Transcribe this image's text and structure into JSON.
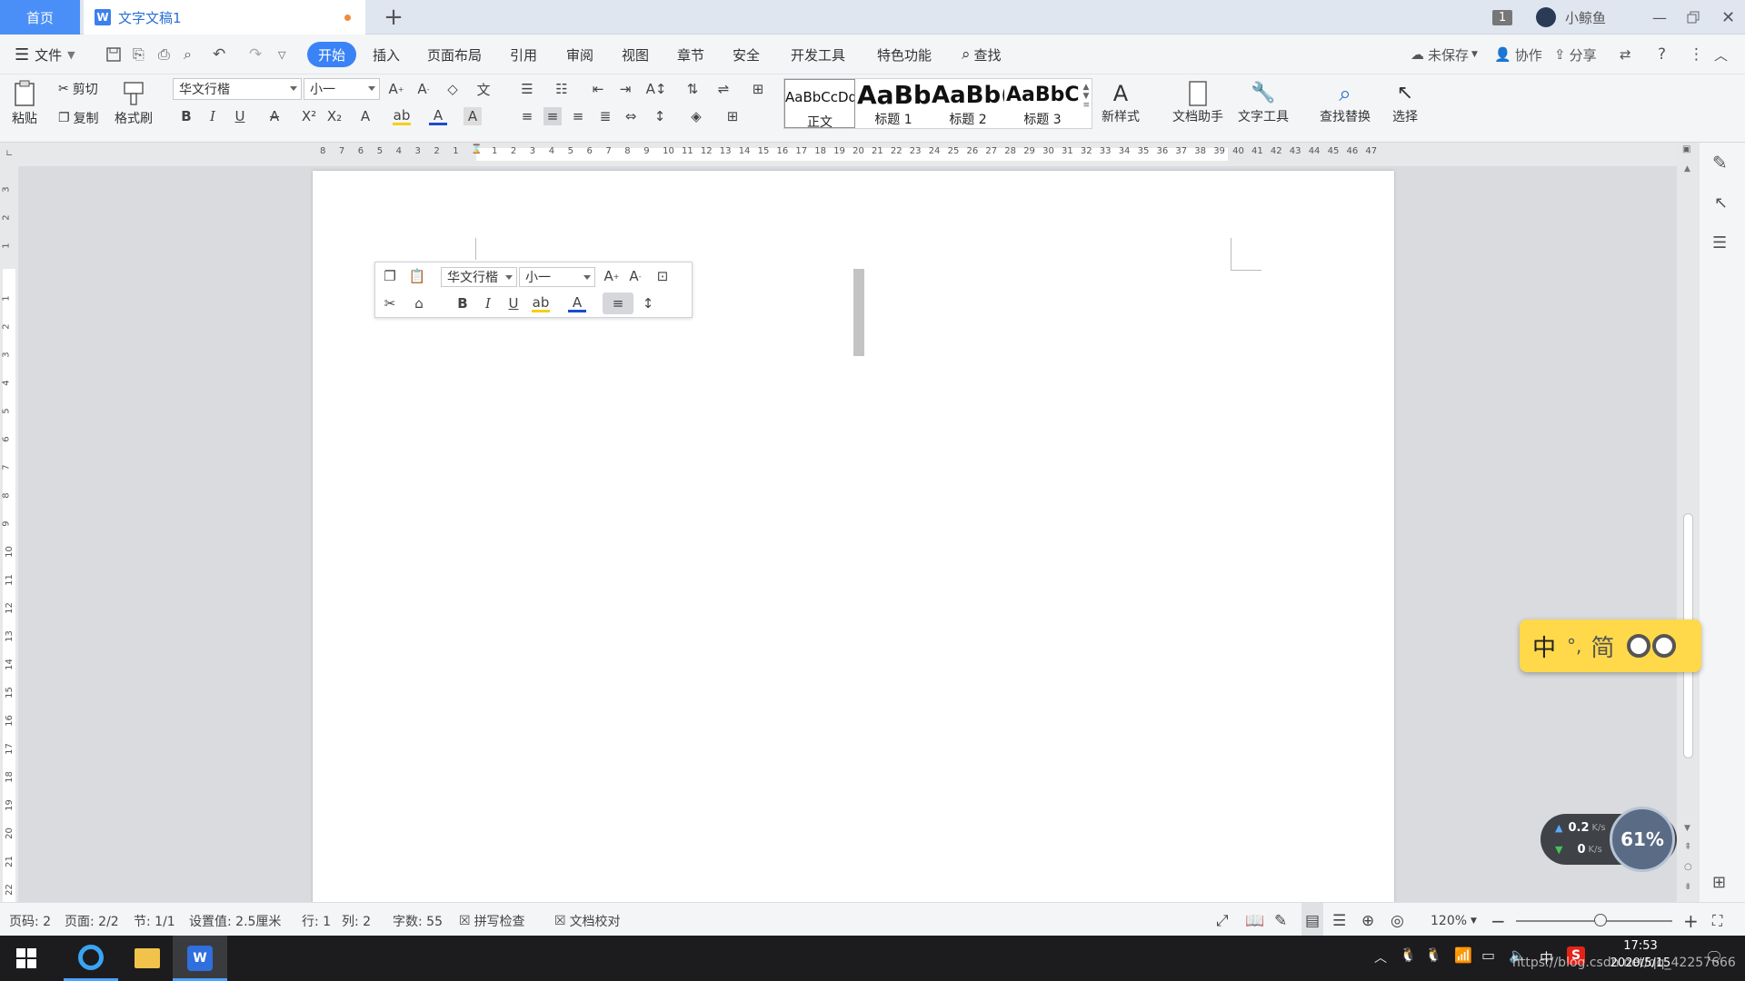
{
  "titlebar": {
    "home_tab": "首页",
    "doc_tab": "文字文稿1",
    "notification_count": "1",
    "username": "小鲸鱼"
  },
  "menu": {
    "file": "文件",
    "items": [
      "开始",
      "插入",
      "页面布局",
      "引用",
      "审阅",
      "视图",
      "章节",
      "安全",
      "开发工具",
      "特色功能"
    ],
    "search": "查找",
    "unsaved": "未保存",
    "collab": "协作",
    "share": "分享"
  },
  "ribbon": {
    "paste": "粘贴",
    "cut": "剪切",
    "copy": "复制",
    "format_painter": "格式刷",
    "font_name": "华文行楷",
    "font_size": "小一",
    "styles": [
      {
        "preview": "AaBbCcDd",
        "label": "正文"
      },
      {
        "preview": "AaBb",
        "label": "标题 1"
      },
      {
        "preview": "AaBb(",
        "label": "标题 2"
      },
      {
        "preview": "AaBbC",
        "label": "标题 3"
      }
    ],
    "new_style": "新样式",
    "doc_assistant": "文档助手",
    "text_tools": "文字工具",
    "find_replace": "查找替换",
    "select": "选择"
  },
  "ruler": {
    "h_left": [
      "8",
      "7",
      "6",
      "5",
      "4",
      "3",
      "2",
      "1"
    ],
    "h_right": [
      "1",
      "2",
      "3",
      "4",
      "5",
      "6",
      "7",
      "8",
      "9",
      "10",
      "11",
      "12",
      "13",
      "14",
      "15",
      "16",
      "17",
      "18",
      "19",
      "20",
      "21",
      "22",
      "23",
      "24",
      "25",
      "26",
      "27",
      "28",
      "29",
      "30",
      "31",
      "32",
      "33",
      "34",
      "35",
      "36",
      "37",
      "38",
      "39",
      "40",
      "41",
      "42",
      "43",
      "44",
      "45",
      "46",
      "47"
    ],
    "v_top": [
      "3",
      "2",
      "1"
    ],
    "v_main": [
      "1",
      "2",
      "3",
      "4",
      "5",
      "6",
      "7",
      "8",
      "9",
      "10",
      "11",
      "12",
      "13",
      "14",
      "15",
      "16",
      "17",
      "18",
      "19",
      "20",
      "21",
      "22"
    ]
  },
  "float_toolbar": {
    "font_name": "华文行楷",
    "font_size": "小一"
  },
  "statusbar": {
    "page_no": "页码: 2",
    "pages": "页面: 2/2",
    "section": "节: 1/1",
    "setting": "设置值: 2.5厘米",
    "row": "行: 1",
    "col": "列: 2",
    "words": "字数: 55",
    "spell": "拼写检查",
    "proof": "文档校对",
    "zoom": "120%"
  },
  "ime": {
    "mode": "中",
    "punct": "°,",
    "simp": "简"
  },
  "net": {
    "up": "0.2",
    "down": "0",
    "unit": "K/s",
    "percent": "61%"
  },
  "taskbar": {
    "time": "17:53",
    "date": "2020/5/15",
    "url": "https://blog.csdn.net/qq_42257666",
    "lang": "中"
  },
  "colors": {
    "accent": "#3a83f6",
    "home_tab": "#4a8ff7",
    "ime_bg": "#ffd94a"
  }
}
